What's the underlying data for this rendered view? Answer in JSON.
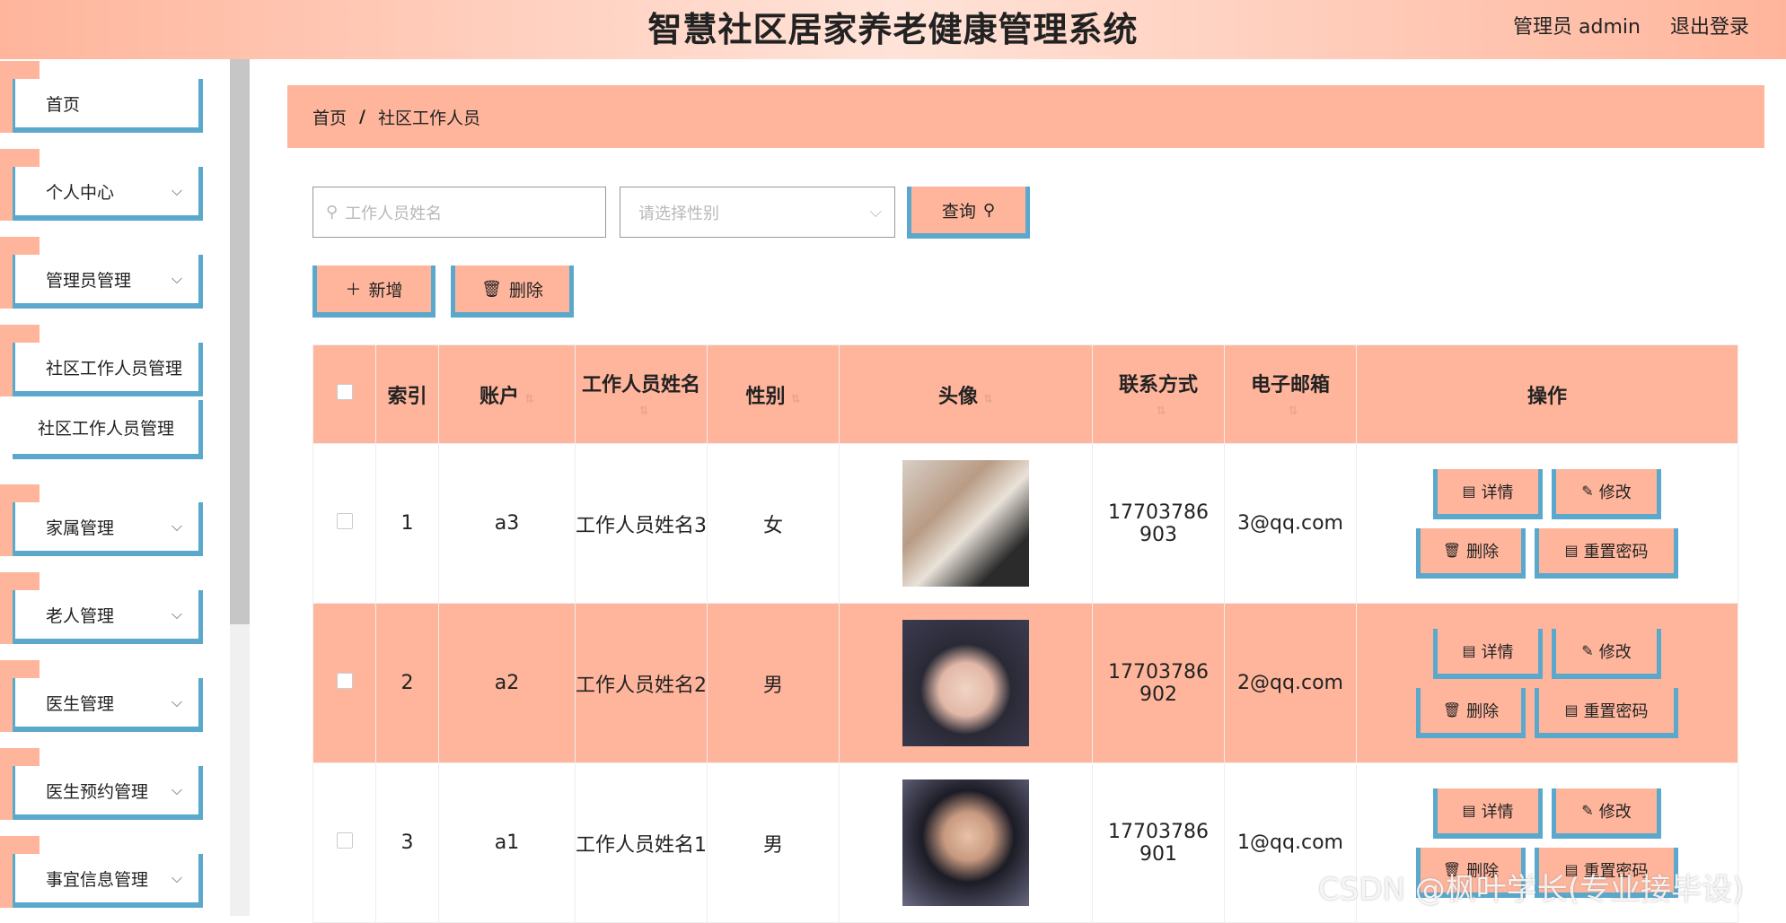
{
  "header": {
    "title": "智慧社区居家养老健康管理系统",
    "admin_label": "管理员 admin",
    "logout_label": "退出登录"
  },
  "sidebar": {
    "items": [
      {
        "label": "首页",
        "has_chevron": false
      },
      {
        "label": "个人中心",
        "has_chevron": true
      },
      {
        "label": "管理员管理",
        "has_chevron": true
      },
      {
        "label": "社区工作人员管理",
        "has_chevron": false
      },
      {
        "label": "社区工作人员管理",
        "has_chevron": false
      },
      {
        "label": "家属管理",
        "has_chevron": true
      },
      {
        "label": "老人管理",
        "has_chevron": true
      },
      {
        "label": "医生管理",
        "has_chevron": true
      },
      {
        "label": "医生预约管理",
        "has_chevron": true
      },
      {
        "label": "事宜信息管理",
        "has_chevron": true
      }
    ],
    "chevron": "⌵"
  },
  "breadcrumb": {
    "home": "首页",
    "separator": "/",
    "current": "社区工作人员"
  },
  "search": {
    "name_placeholder": "工作人员姓名",
    "gender_placeholder": "请选择性别",
    "query_label": "查询"
  },
  "actions": {
    "add_label": "新增",
    "delete_label": "删除"
  },
  "table": {
    "headers": {
      "index": "索引",
      "account": "账户",
      "name": "工作人员姓名",
      "gender": "性别",
      "avatar": "头像",
      "phone": "联系方式",
      "email": "电子邮箱",
      "ops": "操作"
    },
    "rows": [
      {
        "index": "1",
        "account": "a3",
        "name": "工作人员姓名3",
        "gender": "女",
        "phone": "17703786903",
        "email": "3@qq.com",
        "checked": false
      },
      {
        "index": "2",
        "account": "a2",
        "name": "工作人员姓名2",
        "gender": "男",
        "phone": "17703786902",
        "email": "2@qq.com",
        "checked": false
      },
      {
        "index": "3",
        "account": "a1",
        "name": "工作人员姓名1",
        "gender": "男",
        "phone": "17703786901",
        "email": "1@qq.com",
        "checked": false
      }
    ],
    "op_labels": {
      "detail": "详情",
      "edit": "修改",
      "delete": "删除",
      "reset": "重置密码"
    }
  },
  "watermark": "CSDN @枫叶学长(专业接毕设)",
  "colors": {
    "accent": "#ffb59c",
    "border_accent": "#5aa9cc"
  }
}
